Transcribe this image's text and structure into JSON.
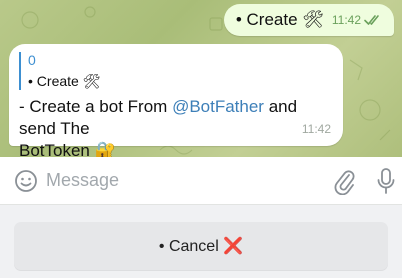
{
  "chat": {
    "outgoing": {
      "text": "• Create 🛠",
      "time": "11:42"
    },
    "incoming": {
      "quote_title": "0",
      "quote_text": "• Create 🛠",
      "line1_prefix": "- Create a bot From ",
      "mention": "@BotFather",
      "line1_suffix": " and send The",
      "line2": "BotToken 🔐",
      "time": "11:42"
    }
  },
  "input": {
    "placeholder": "Message"
  },
  "keyboard": {
    "button_label": "• Cancel ❌"
  },
  "icons": {
    "emoji": "emoji-icon",
    "attach": "paperclip-icon",
    "mic": "microphone-icon",
    "read_receipt": "double-check-icon"
  },
  "colors": {
    "accent": "#3d8fd1",
    "outgoing_bubble": "#effdde",
    "check": "#6aa05b"
  }
}
